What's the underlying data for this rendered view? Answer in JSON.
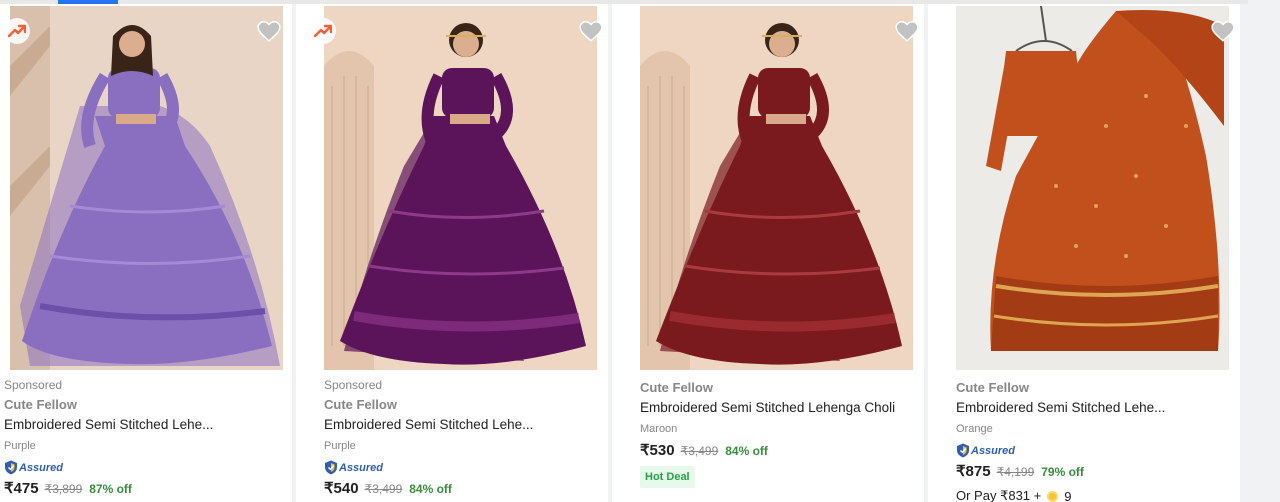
{
  "products": [
    {
      "sponsored": "Sponsored",
      "brand": "Cute Fellow",
      "title": "Embroidered Semi Stitched Lehe...",
      "variant": "Purple",
      "assured": "Assured",
      "price": "₹475",
      "mrp": "₹3,899",
      "discount": "87% off",
      "dress_color": "#8a6fc1",
      "bg_color": "#e7d5c6"
    },
    {
      "sponsored": "Sponsored",
      "brand": "Cute Fellow",
      "title": "Embroidered Semi Stitched Lehe...",
      "variant": "Purple",
      "assured": "Assured",
      "price": "₹540",
      "mrp": "₹3,499",
      "discount": "84% off",
      "dress_color": "#5b1459",
      "bg_color": "#ecd3bf"
    },
    {
      "brand": "Cute Fellow",
      "title": "Embroidered Semi Stitched Lehenga Choli",
      "variant": "Maroon",
      "price": "₹530",
      "mrp": "₹3,499",
      "discount": "84% off",
      "badge": "Hot Deal",
      "dress_color": "#7a1a1f",
      "bg_color": "#ecd3bf"
    },
    {
      "brand": "Cute Fellow",
      "title": "Embroidered Semi Stitched Lehe...",
      "variant": "Orange",
      "assured": "Assured",
      "price": "₹875",
      "mrp": "₹4,199",
      "discount": "79% off",
      "pay_text": "Or Pay ₹831 +",
      "coins": "9",
      "dress_color": "#c2501c",
      "bg_color": "#ecebe7"
    }
  ],
  "colors": {
    "accent": "#2874f0",
    "discount_green": "#388e3c",
    "trend_red": "#ff5c35",
    "assured_blue": "#2f5eb3"
  }
}
